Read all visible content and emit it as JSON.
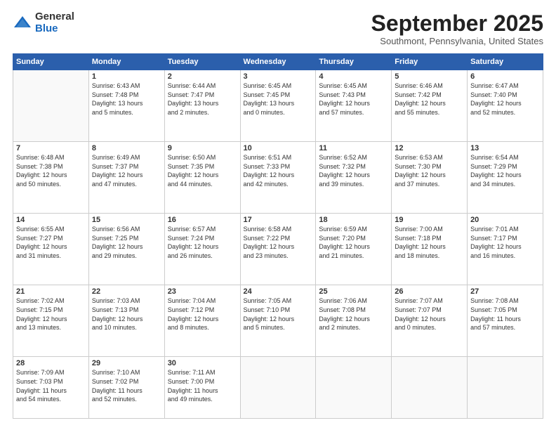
{
  "logo": {
    "general": "General",
    "blue": "Blue"
  },
  "header": {
    "month": "September 2025",
    "location": "Southmont, Pennsylvania, United States"
  },
  "weekdays": [
    "Sunday",
    "Monday",
    "Tuesday",
    "Wednesday",
    "Thursday",
    "Friday",
    "Saturday"
  ],
  "weeks": [
    [
      {
        "day": "",
        "info": ""
      },
      {
        "day": "1",
        "info": "Sunrise: 6:43 AM\nSunset: 7:48 PM\nDaylight: 13 hours\nand 5 minutes."
      },
      {
        "day": "2",
        "info": "Sunrise: 6:44 AM\nSunset: 7:47 PM\nDaylight: 13 hours\nand 2 minutes."
      },
      {
        "day": "3",
        "info": "Sunrise: 6:45 AM\nSunset: 7:45 PM\nDaylight: 13 hours\nand 0 minutes."
      },
      {
        "day": "4",
        "info": "Sunrise: 6:45 AM\nSunset: 7:43 PM\nDaylight: 12 hours\nand 57 minutes."
      },
      {
        "day": "5",
        "info": "Sunrise: 6:46 AM\nSunset: 7:42 PM\nDaylight: 12 hours\nand 55 minutes."
      },
      {
        "day": "6",
        "info": "Sunrise: 6:47 AM\nSunset: 7:40 PM\nDaylight: 12 hours\nand 52 minutes."
      }
    ],
    [
      {
        "day": "7",
        "info": "Sunrise: 6:48 AM\nSunset: 7:38 PM\nDaylight: 12 hours\nand 50 minutes."
      },
      {
        "day": "8",
        "info": "Sunrise: 6:49 AM\nSunset: 7:37 PM\nDaylight: 12 hours\nand 47 minutes."
      },
      {
        "day": "9",
        "info": "Sunrise: 6:50 AM\nSunset: 7:35 PM\nDaylight: 12 hours\nand 44 minutes."
      },
      {
        "day": "10",
        "info": "Sunrise: 6:51 AM\nSunset: 7:33 PM\nDaylight: 12 hours\nand 42 minutes."
      },
      {
        "day": "11",
        "info": "Sunrise: 6:52 AM\nSunset: 7:32 PM\nDaylight: 12 hours\nand 39 minutes."
      },
      {
        "day": "12",
        "info": "Sunrise: 6:53 AM\nSunset: 7:30 PM\nDaylight: 12 hours\nand 37 minutes."
      },
      {
        "day": "13",
        "info": "Sunrise: 6:54 AM\nSunset: 7:29 PM\nDaylight: 12 hours\nand 34 minutes."
      }
    ],
    [
      {
        "day": "14",
        "info": "Sunrise: 6:55 AM\nSunset: 7:27 PM\nDaylight: 12 hours\nand 31 minutes."
      },
      {
        "day": "15",
        "info": "Sunrise: 6:56 AM\nSunset: 7:25 PM\nDaylight: 12 hours\nand 29 minutes."
      },
      {
        "day": "16",
        "info": "Sunrise: 6:57 AM\nSunset: 7:24 PM\nDaylight: 12 hours\nand 26 minutes."
      },
      {
        "day": "17",
        "info": "Sunrise: 6:58 AM\nSunset: 7:22 PM\nDaylight: 12 hours\nand 23 minutes."
      },
      {
        "day": "18",
        "info": "Sunrise: 6:59 AM\nSunset: 7:20 PM\nDaylight: 12 hours\nand 21 minutes."
      },
      {
        "day": "19",
        "info": "Sunrise: 7:00 AM\nSunset: 7:18 PM\nDaylight: 12 hours\nand 18 minutes."
      },
      {
        "day": "20",
        "info": "Sunrise: 7:01 AM\nSunset: 7:17 PM\nDaylight: 12 hours\nand 16 minutes."
      }
    ],
    [
      {
        "day": "21",
        "info": "Sunrise: 7:02 AM\nSunset: 7:15 PM\nDaylight: 12 hours\nand 13 minutes."
      },
      {
        "day": "22",
        "info": "Sunrise: 7:03 AM\nSunset: 7:13 PM\nDaylight: 12 hours\nand 10 minutes."
      },
      {
        "day": "23",
        "info": "Sunrise: 7:04 AM\nSunset: 7:12 PM\nDaylight: 12 hours\nand 8 minutes."
      },
      {
        "day": "24",
        "info": "Sunrise: 7:05 AM\nSunset: 7:10 PM\nDaylight: 12 hours\nand 5 minutes."
      },
      {
        "day": "25",
        "info": "Sunrise: 7:06 AM\nSunset: 7:08 PM\nDaylight: 12 hours\nand 2 minutes."
      },
      {
        "day": "26",
        "info": "Sunrise: 7:07 AM\nSunset: 7:07 PM\nDaylight: 12 hours\nand 0 minutes."
      },
      {
        "day": "27",
        "info": "Sunrise: 7:08 AM\nSunset: 7:05 PM\nDaylight: 11 hours\nand 57 minutes."
      }
    ],
    [
      {
        "day": "28",
        "info": "Sunrise: 7:09 AM\nSunset: 7:03 PM\nDaylight: 11 hours\nand 54 minutes."
      },
      {
        "day": "29",
        "info": "Sunrise: 7:10 AM\nSunset: 7:02 PM\nDaylight: 11 hours\nand 52 minutes."
      },
      {
        "day": "30",
        "info": "Sunrise: 7:11 AM\nSunset: 7:00 PM\nDaylight: 11 hours\nand 49 minutes."
      },
      {
        "day": "",
        "info": ""
      },
      {
        "day": "",
        "info": ""
      },
      {
        "day": "",
        "info": ""
      },
      {
        "day": "",
        "info": ""
      }
    ]
  ]
}
